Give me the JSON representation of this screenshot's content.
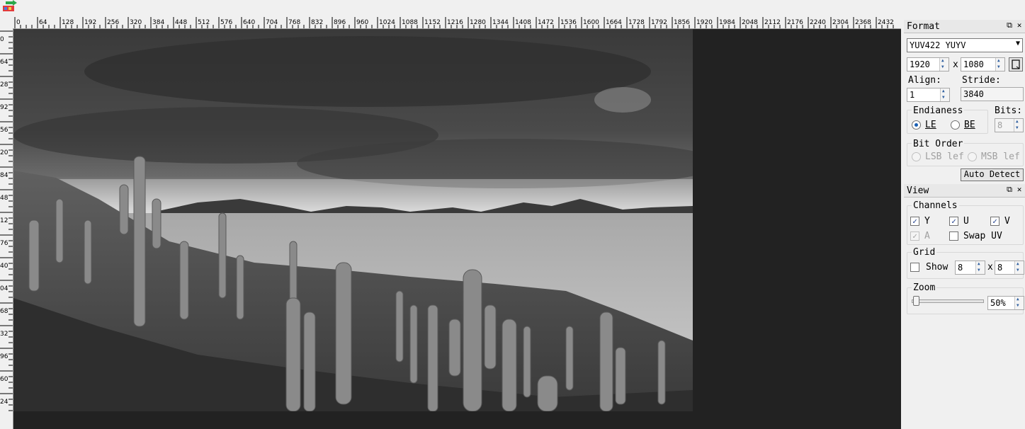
{
  "ruler": {
    "top_labels": [
      "0",
      "64",
      "128",
      "192",
      "256",
      "320",
      "384",
      "448",
      "512",
      "576",
      "640",
      "704",
      "768",
      "832",
      "896",
      "960",
      "1024",
      "1088",
      "1152",
      "1216",
      "1280",
      "1344",
      "1408",
      "1472",
      "1536",
      "1600",
      "1664",
      "1728",
      "1792",
      "1856",
      "1920",
      "1984",
      "2048",
      "2112",
      "2176",
      "2240",
      "2304",
      "2368",
      "2432"
    ],
    "left_labels": [
      "0",
      "64",
      "28",
      "92",
      "56",
      "20",
      "84",
      "48",
      "12",
      "76",
      "40",
      "04",
      "68",
      "32",
      "96",
      "60",
      "24"
    ]
  },
  "format": {
    "title": "Format",
    "pixel_format": "YUV422 YUYV",
    "width": "1920",
    "height": "1080",
    "x_sep": "x",
    "align_label": "Align:",
    "align_value": "1",
    "stride_label": "Stride:",
    "stride_value": "3840",
    "endianess_label": "Endianess",
    "le_label": "LE",
    "be_label": "BE",
    "endianess_selected": "LE",
    "bits_label": "Bits:",
    "bits_value": "8",
    "bit_order_label": "Bit Order",
    "lsb_label": "LSB lef",
    "msb_label": "MSB lef",
    "auto_detect_label": "Auto Detect"
  },
  "view": {
    "title": "View",
    "channels_label": "Channels",
    "y_label": "Y",
    "u_label": "U",
    "v_label": "V",
    "a_label": "A",
    "swap_uv_label": "Swap UV",
    "y_checked": true,
    "u_checked": true,
    "v_checked": true,
    "a_checked": true,
    "swap_uv_checked": false,
    "grid_label": "Grid",
    "grid_show_label": "Show",
    "grid_show_checked": false,
    "grid_x": "8",
    "grid_y": "8",
    "grid_sep": "x",
    "zoom_label": "Zoom",
    "zoom_value": "50%"
  },
  "colors": {
    "viewport_bg": "#222222",
    "panel_bg": "#f0f0f0",
    "accent": "#1a5fb4"
  }
}
